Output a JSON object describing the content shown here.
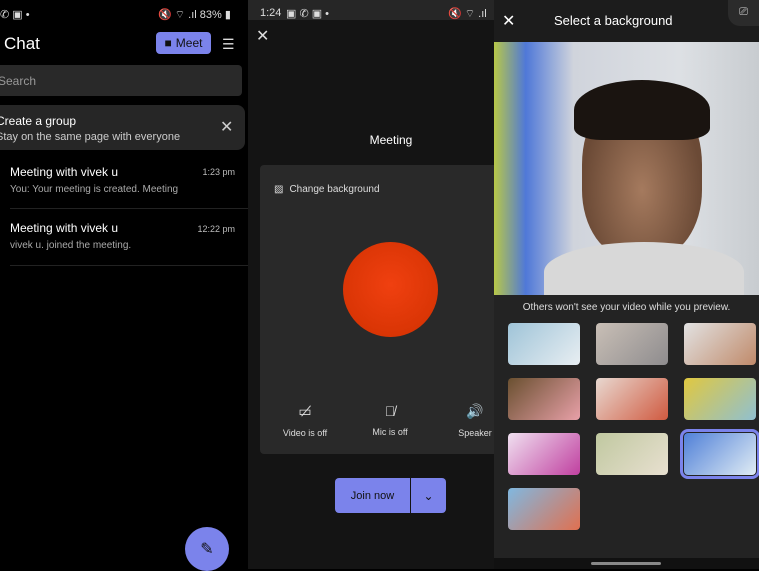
{
  "chat": {
    "status": {
      "battery": "83%"
    },
    "title": "Chat",
    "meet_label": "Meet",
    "search_placeholder": "Search",
    "banner": {
      "title": "Create a group",
      "subtitle": "Stay on the same page with everyone"
    },
    "items": [
      {
        "name": "Meeting with vivek u",
        "time": "1:23 pm",
        "preview": "You: Your meeting is created. Meeting"
      },
      {
        "name": "Meeting with vivek u",
        "time": "12:22 pm",
        "preview": "vivek u. joined the meeting."
      }
    ]
  },
  "meeting": {
    "status": {
      "time": "1:24"
    },
    "title": "Meeting",
    "change_background": "Change background",
    "controls": [
      {
        "label": "Video is off",
        "icon": "video-off-icon"
      },
      {
        "label": "Mic is off",
        "icon": "mic-off-icon"
      },
      {
        "label": "Speaker",
        "icon": "speaker-icon"
      }
    ],
    "join_label": "Join now",
    "avatar_color": "#e03a10"
  },
  "background": {
    "title": "Select a background",
    "caption": "Others won't see your video while you preview.",
    "accent": "#7b83eb",
    "thumbnails": [
      {
        "colors": [
          "#9fc4d8",
          "#e8eef2"
        ]
      },
      {
        "colors": [
          "#c9bfb6",
          "#8e8c8e"
        ]
      },
      {
        "colors": [
          "#e2e2e2",
          "#c08a6a"
        ]
      },
      {
        "colors": [
          "#6a5030",
          "#e8a0a8"
        ]
      },
      {
        "colors": [
          "#e8d8d0",
          "#d05a40"
        ]
      },
      {
        "colors": [
          "#e0c840",
          "#90c0d0"
        ]
      },
      {
        "colors": [
          "#f0e0f0",
          "#c040a0"
        ]
      },
      {
        "colors": [
          "#c0c8a0",
          "#e8e0d0"
        ]
      },
      {
        "colors": [
          "#5080d8",
          "#e0ecf4"
        ],
        "selected": true
      },
      {
        "colors": [
          "#80b8e0",
          "#e07050"
        ]
      }
    ]
  }
}
